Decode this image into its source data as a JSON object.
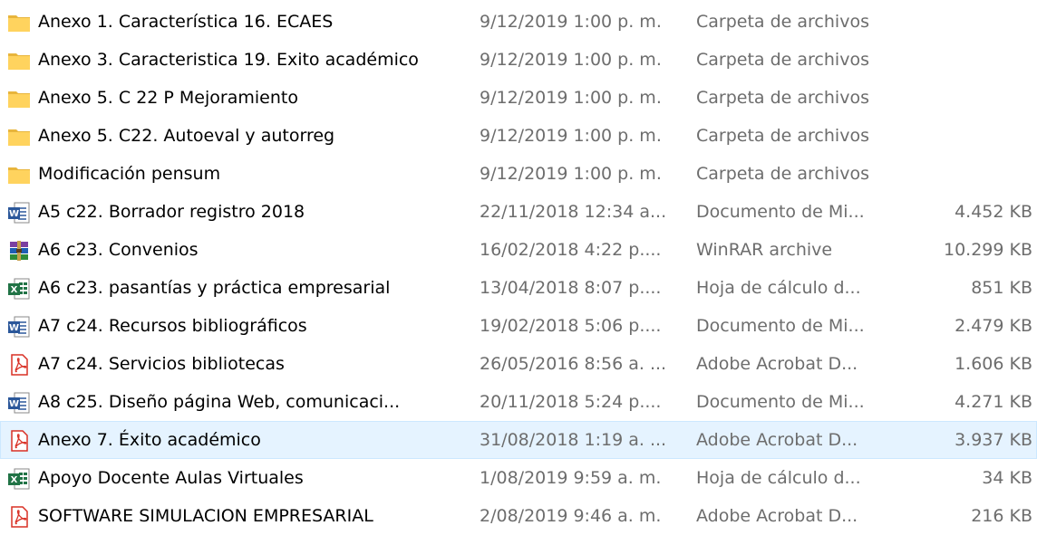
{
  "files": [
    {
      "icon": "folder-icon",
      "name": "Anexo 1. Característica 16. ECAES",
      "date": "9/12/2019 1:00 p. m.",
      "type": "Carpeta de archivos",
      "size": ""
    },
    {
      "icon": "folder-icon",
      "name": "Anexo 3. Caracteristica 19. Exito académico",
      "date": "9/12/2019 1:00 p. m.",
      "type": "Carpeta de archivos",
      "size": ""
    },
    {
      "icon": "folder-icon",
      "name": "Anexo 5. C 22 P Mejoramiento",
      "date": "9/12/2019 1:00 p. m.",
      "type": "Carpeta de archivos",
      "size": ""
    },
    {
      "icon": "folder-icon",
      "name": "Anexo 5. C22. Autoeval y autorreg",
      "date": "9/12/2019 1:00 p. m.",
      "type": "Carpeta de archivos",
      "size": ""
    },
    {
      "icon": "folder-icon",
      "name": "Modificación pensum",
      "date": "9/12/2019 1:00 p. m.",
      "type": "Carpeta de archivos",
      "size": ""
    },
    {
      "icon": "word-document-icon",
      "name": "A5 c22. Borrador registro 2018",
      "date": "22/11/2018 12:34 a...",
      "type": "Documento de Mi...",
      "size": "4.452 KB"
    },
    {
      "icon": "winrar-archive-icon",
      "name": "A6 c23. Convenios",
      "date": "16/02/2018 4:22 p....",
      "type": "WinRAR archive",
      "size": "10.299 KB"
    },
    {
      "icon": "excel-spreadsheet-icon",
      "name": "A6 c23. pasantías y práctica empresarial",
      "date": "13/04/2018 8:07 p....",
      "type": "Hoja de cálculo d...",
      "size": "851 KB"
    },
    {
      "icon": "word-document-icon",
      "name": "A7 c24. Recursos bibliográficos",
      "date": "19/02/2018 5:06 p....",
      "type": "Documento de Mi...",
      "size": "2.479 KB"
    },
    {
      "icon": "pdf-document-icon",
      "name": "A7 c24. Servicios bibliotecas",
      "date": "26/05/2016 8:56 a. ...",
      "type": "Adobe Acrobat D...",
      "size": "1.606 KB"
    },
    {
      "icon": "word-document-icon",
      "name": "A8 c25. Diseño página Web, comunicaci...",
      "date": "20/11/2018 5:24 p....",
      "type": "Documento de Mi...",
      "size": "4.271 KB"
    },
    {
      "icon": "pdf-document-icon",
      "name": "Anexo 7.  Éxito académico",
      "date": "31/08/2018 1:19 a. ...",
      "type": "Adobe Acrobat D...",
      "size": "3.937 KB",
      "selected": true
    },
    {
      "icon": "excel-spreadsheet-icon",
      "name": "Apoyo Docente Aulas Virtuales",
      "date": "1/08/2019 9:59 a. m.",
      "type": "Hoja de cálculo d...",
      "size": "34 KB"
    },
    {
      "icon": "pdf-document-icon",
      "name": "SOFTWARE SIMULACION EMPRESARIAL",
      "date": "2/08/2019 9:46 a. m.",
      "type": "Adobe Acrobat D...",
      "size": "216 KB"
    }
  ],
  "colors": {
    "selection_background": "#e5f3ff",
    "selection_border": "#cce8ff",
    "folder": "#ffd35e",
    "word": "#2b579a",
    "excel": "#217346",
    "pdf": "#d93025",
    "secondary_text": "#6d6d6d"
  }
}
